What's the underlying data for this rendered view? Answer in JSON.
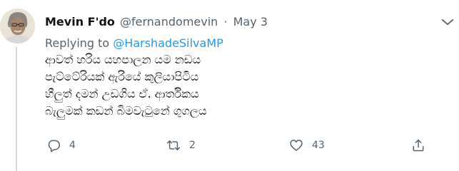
{
  "tweet": {
    "author_name": "Mevin F'do",
    "handle": "@fernandomevin",
    "separator": "·",
    "date": "May 3",
    "replying_to_prefix": "Replying to",
    "replying_to_handle": "@HarshadeSilvaMP",
    "text": "ආවත් හරිය යහපාලන  යම නඩය\nපැට්ටේරියක් ඇරියේ   කුලියාපිටිය\nහීලුත් දමන් උඩගිය ඒ.  ආර්තිකය\nබැලුමක් කඩන් බිමවැටුනේ ගුගලය",
    "counts": {
      "replies": "4",
      "retweets": "2",
      "likes": "43"
    }
  },
  "icons": {
    "more": "chevron-down-icon",
    "reply": "reply-icon",
    "retweet": "retweet-icon",
    "like": "heart-icon",
    "share": "share-icon"
  },
  "colors": {
    "text": "#0f1419",
    "muted": "#536471",
    "link": "#1d9bf0",
    "line": "#cfd9de"
  }
}
